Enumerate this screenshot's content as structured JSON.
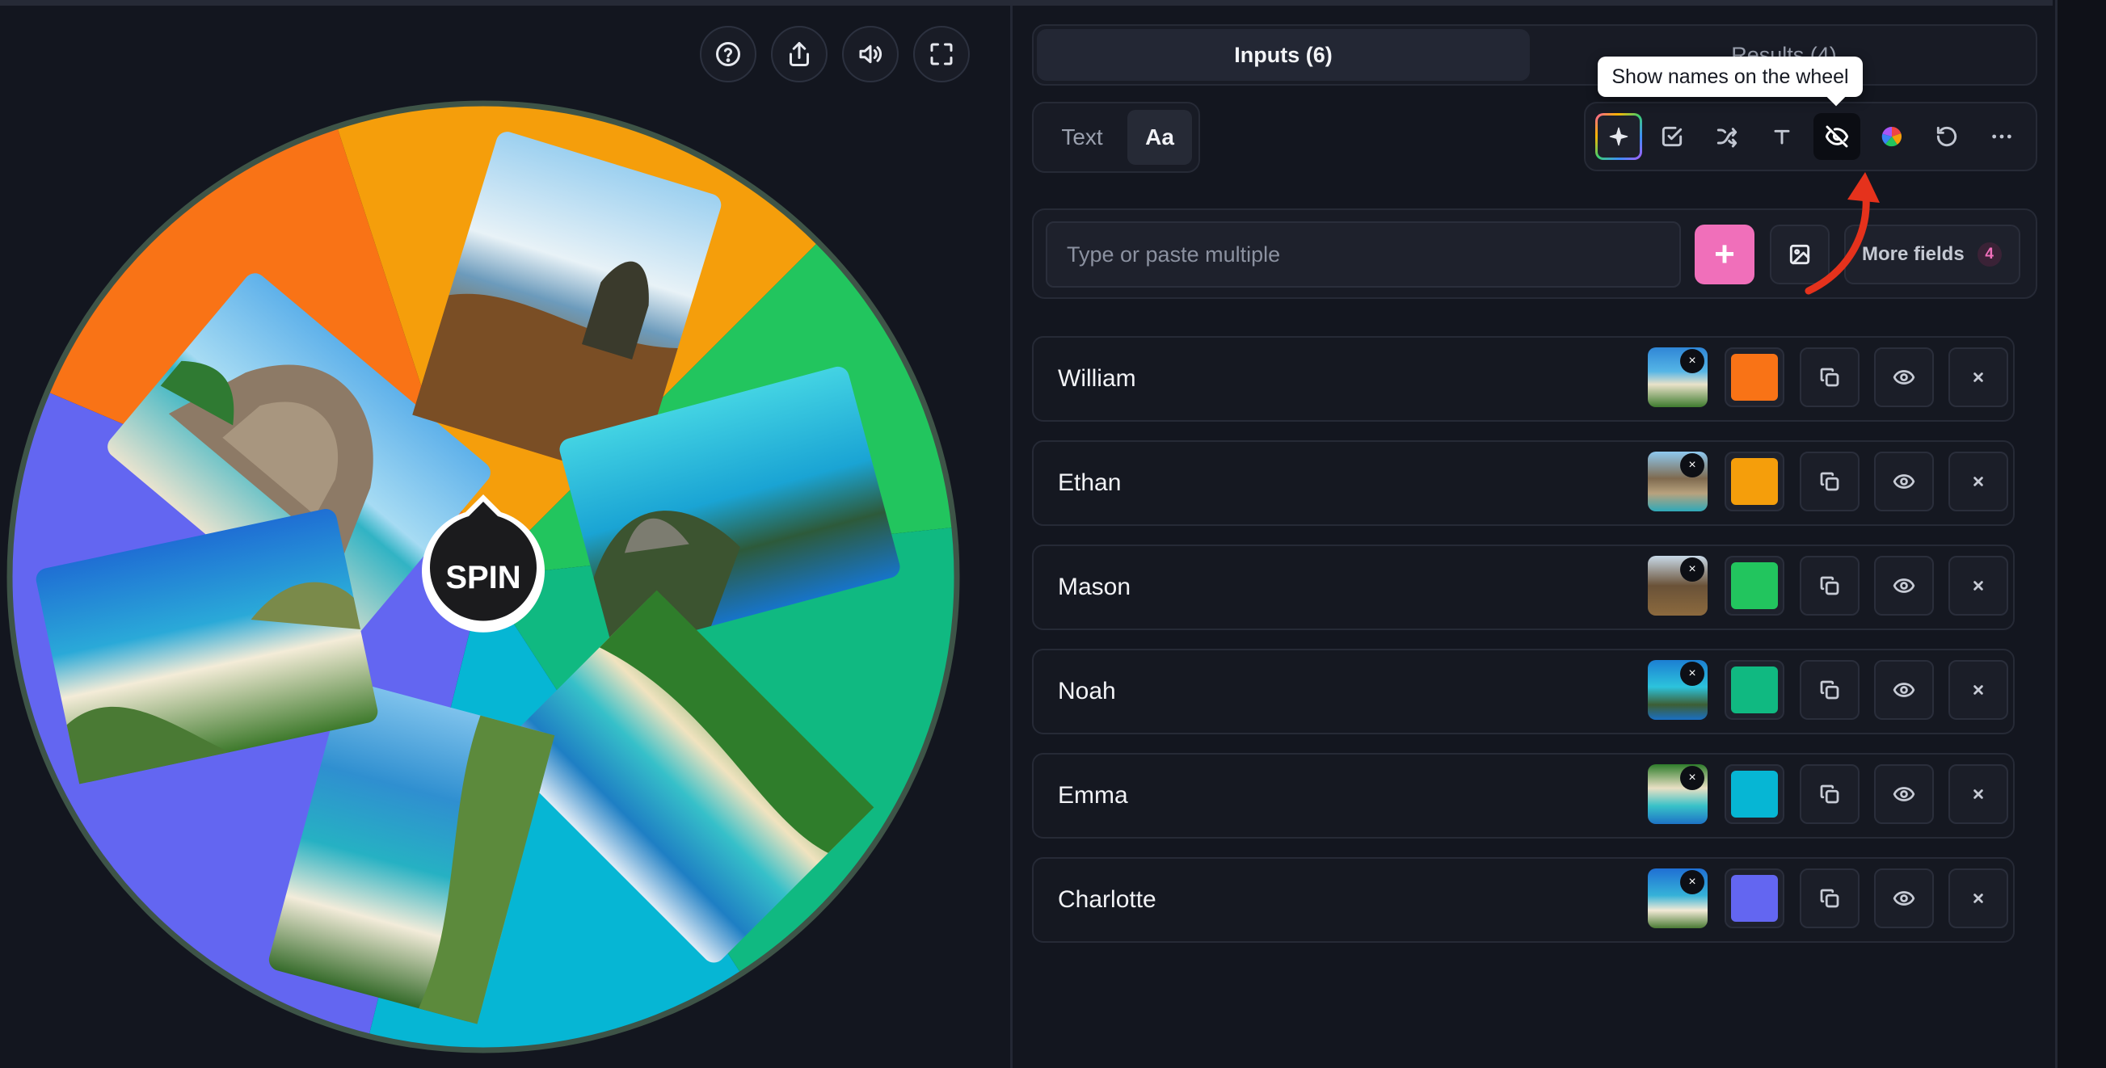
{
  "wheel_toolbar": {
    "icons": [
      "help-icon",
      "share-icon",
      "volume-icon",
      "fullscreen-icon"
    ]
  },
  "wheel": {
    "spin_label": "SPIN",
    "segments": [
      {
        "name": "William",
        "color": "#f97316"
      },
      {
        "name": "Ethan",
        "color": "#f59e0b"
      },
      {
        "name": "Mason",
        "color": "#22c55e"
      },
      {
        "name": "Noah",
        "color": "#10b981"
      },
      {
        "name": "Emma",
        "color": "#06b6d4"
      },
      {
        "name": "Charlotte",
        "color": "#6366f1"
      }
    ]
  },
  "tabs": {
    "inputs": "Inputs (6)",
    "results": "Results (4)"
  },
  "text_mode": {
    "text_label": "Text",
    "aa_label": "Aa"
  },
  "toolbar": {
    "tooltip": "Show names on the wheel",
    "icons": [
      "magic-icon",
      "checkbox-icon",
      "shuffle-icon",
      "text-icon",
      "eye-off-icon",
      "color-wheel-icon",
      "reset-icon",
      "more-icon"
    ]
  },
  "entry": {
    "placeholder": "Type or paste multiple",
    "add_label": "+",
    "more_fields_label": "More fields",
    "more_fields_count": "4"
  },
  "entries": [
    {
      "name": "William",
      "color": "#f97316",
      "remove": "×"
    },
    {
      "name": "Ethan",
      "color": "#f59e0b",
      "remove": "×"
    },
    {
      "name": "Mason",
      "color": "#22c55e",
      "remove": "×"
    },
    {
      "name": "Noah",
      "color": "#10b981",
      "remove": "×"
    },
    {
      "name": "Emma",
      "color": "#06b6d4",
      "remove": "×"
    },
    {
      "name": "Charlotte",
      "color": "#6366f1",
      "remove": "×"
    }
  ],
  "accent_color": "#f06fba"
}
